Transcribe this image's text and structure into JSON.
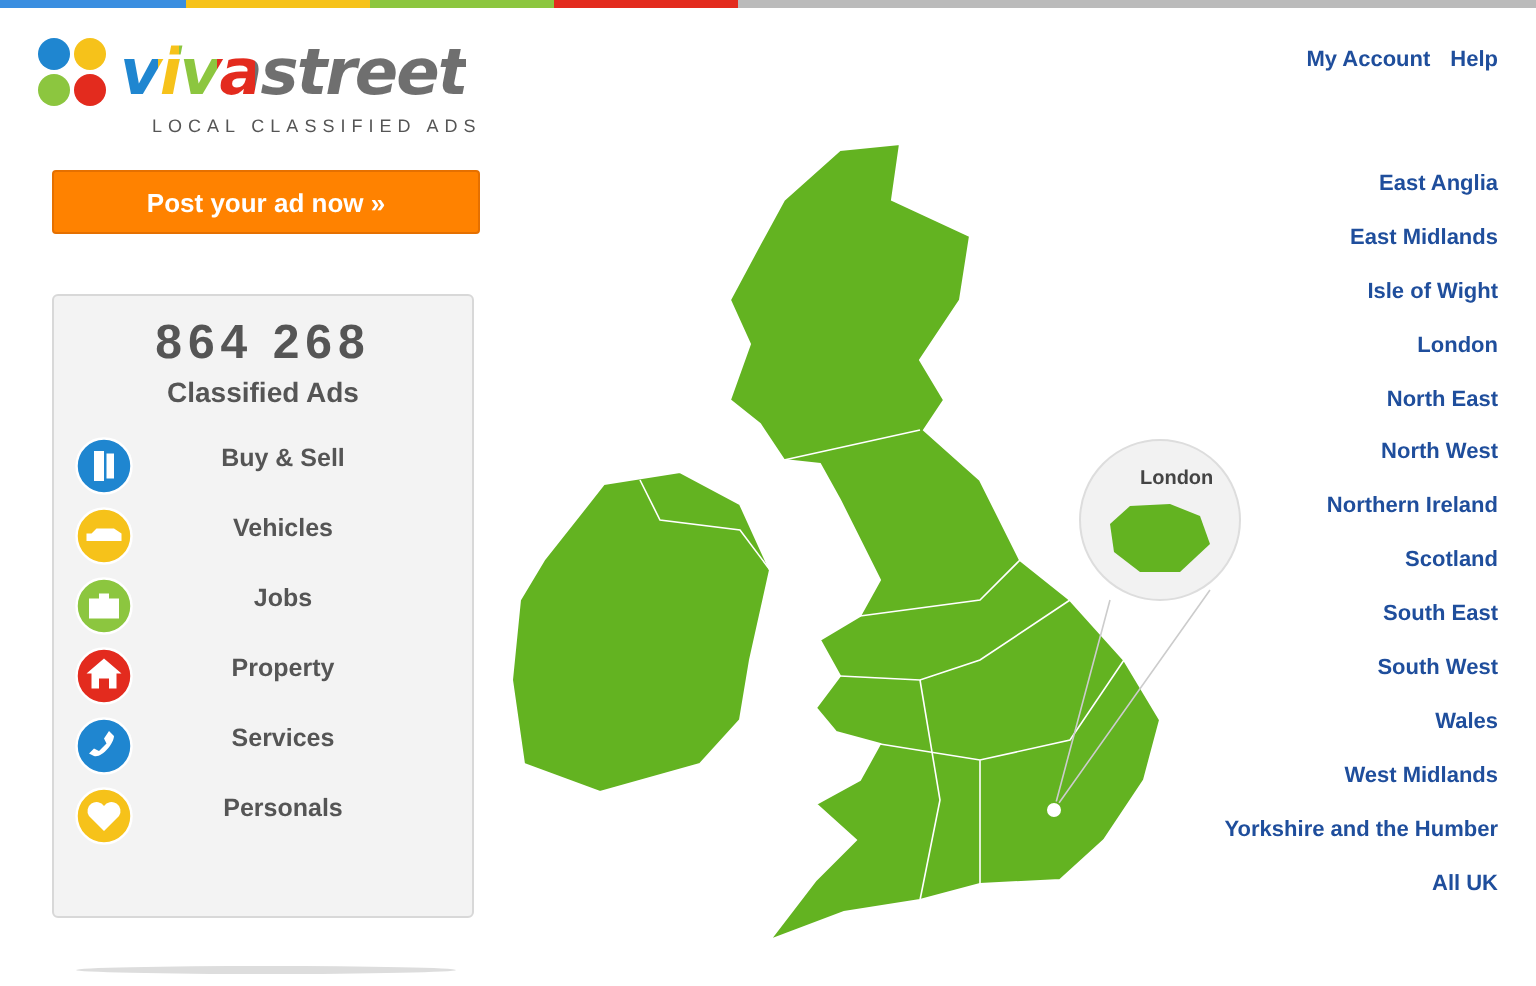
{
  "logo": {
    "name": "vivastreet",
    "tagline": "LOCAL CLASSIFIED ADS"
  },
  "post_button": "Post your ad now »",
  "stats": {
    "count": "864 268",
    "label": "Classified Ads"
  },
  "categories": [
    {
      "kind": "buy-sell",
      "label": "Buy & Sell"
    },
    {
      "kind": "vehicles",
      "label": "Vehicles"
    },
    {
      "kind": "jobs",
      "label": "Jobs"
    },
    {
      "kind": "property",
      "label": "Property"
    },
    {
      "kind": "services",
      "label": "Services"
    },
    {
      "kind": "personals",
      "label": "Personals"
    }
  ],
  "top_links": [
    "My Account",
    "Help"
  ],
  "map": {
    "callout_label": "London"
  },
  "regions": [
    "East Anglia",
    "East Midlands",
    "Isle of Wight",
    "London",
    "North East",
    "North West",
    "Northern Ireland",
    "Scotland",
    "South East",
    "South West",
    "Wales",
    "West Midlands",
    "Yorkshire and the Humber",
    "All UK"
  ]
}
